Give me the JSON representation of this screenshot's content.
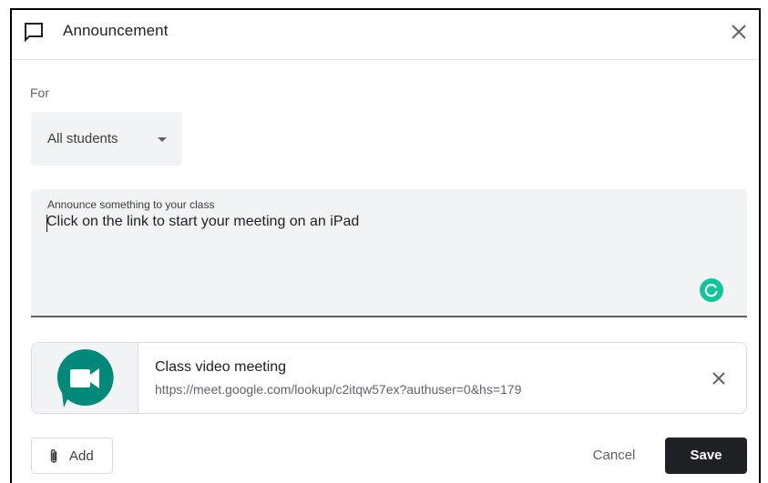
{
  "dialog": {
    "title": "Announcement",
    "header_icon": "announcement-icon",
    "close_icon": "close-icon"
  },
  "audience": {
    "label": "For",
    "selected": "All students"
  },
  "announcement": {
    "label": "Announce something to your class",
    "value": "Click on the link to start your meeting on an iPad"
  },
  "attachment": {
    "title": "Class video meeting",
    "url": "https://meet.google.com/lookup/c2itqw57ex?authuser=0&hs=179",
    "icon": "google-meet-icon"
  },
  "actions": {
    "add_label": "Add",
    "cancel_label": "Cancel",
    "save_label": "Save"
  },
  "colors": {
    "save_bg": "#202124",
    "field_bg": "#f1f3f4",
    "meet_green": "#00897b",
    "grammarly_green": "#15c39a"
  }
}
